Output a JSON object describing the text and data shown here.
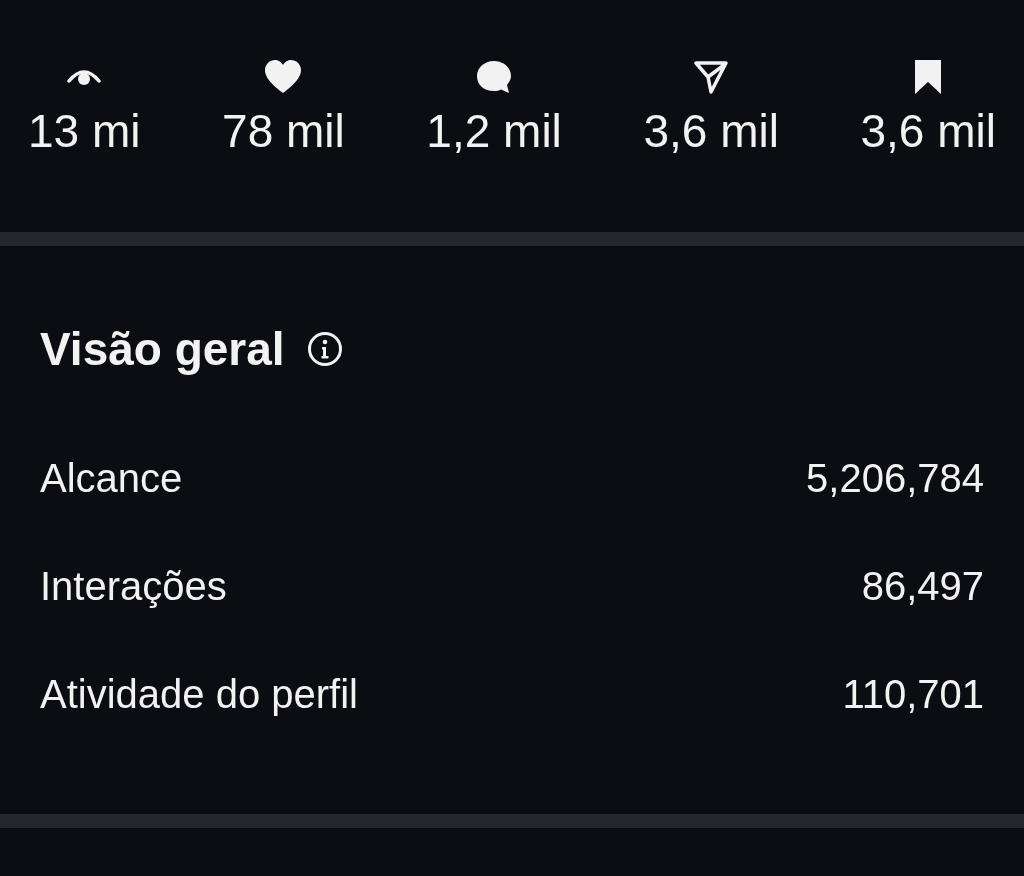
{
  "stats": [
    {
      "kind": "views",
      "value": "13 mi"
    },
    {
      "kind": "likes",
      "value": "78 mil"
    },
    {
      "kind": "comments",
      "value": "1,2 mil"
    },
    {
      "kind": "shares",
      "value": "3,6 mil"
    },
    {
      "kind": "saves",
      "value": "3,6 mil"
    }
  ],
  "overview": {
    "title": "Visão geral",
    "rows": [
      {
        "label": "Alcance",
        "value": "5,206,784"
      },
      {
        "label": "Interações",
        "value": "86,497"
      },
      {
        "label": "Atividade do perfil",
        "value": "110,701"
      }
    ]
  }
}
